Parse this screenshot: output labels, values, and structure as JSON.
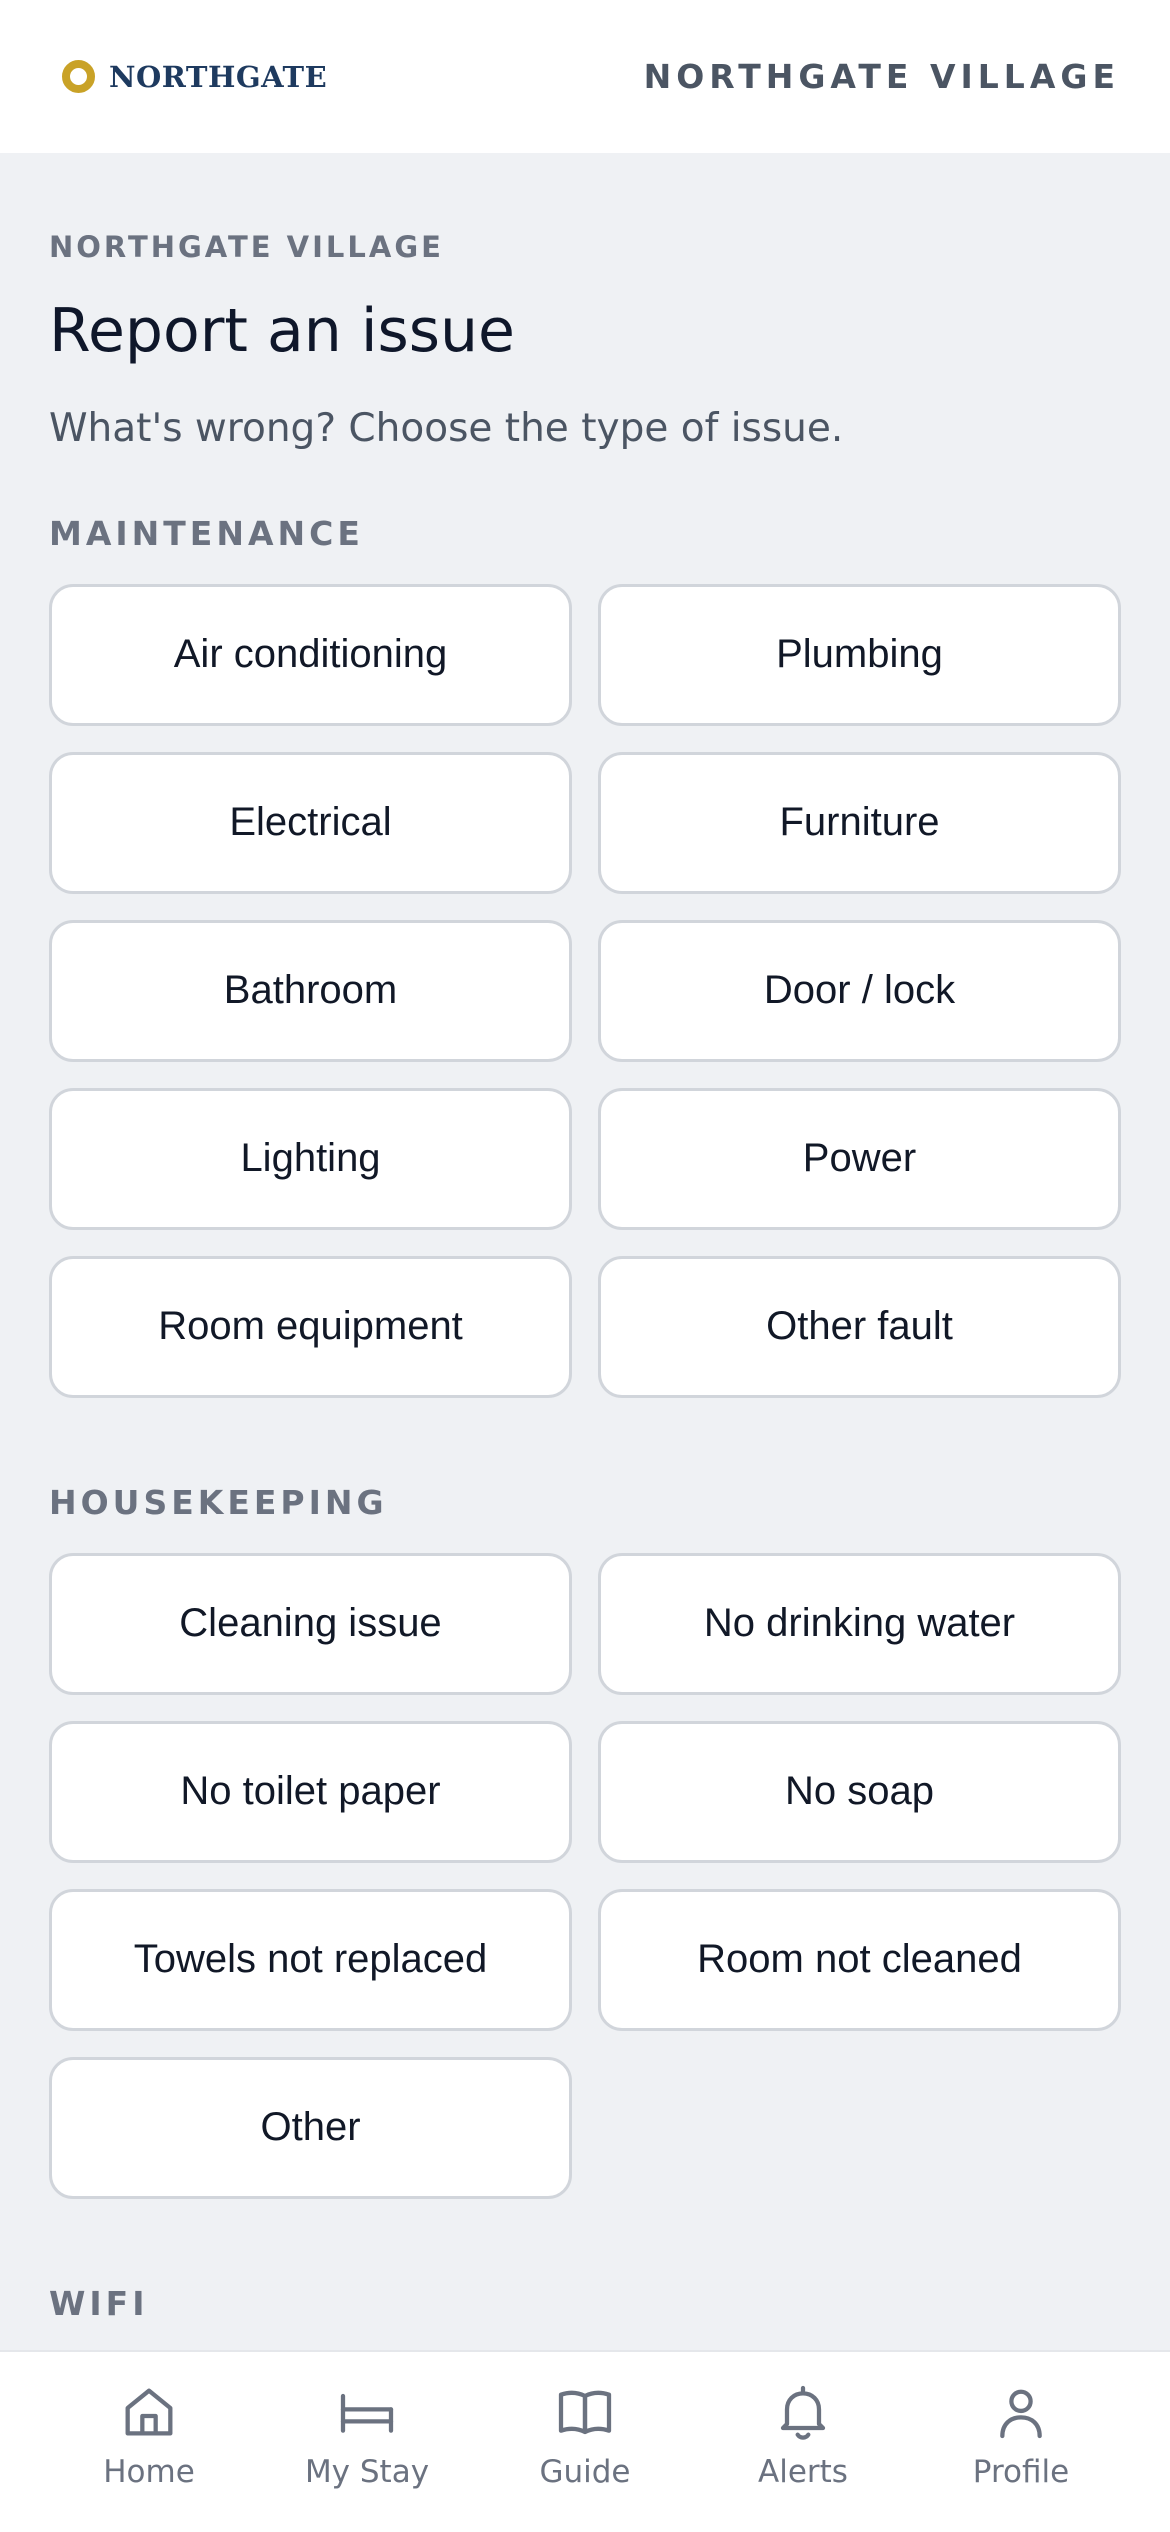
{
  "header": {
    "logo_text": "NORTHGATE",
    "title": "NORTHGATE VILLAGE"
  },
  "page": {
    "eyebrow": "NORTHGATE VILLAGE",
    "title": "Report an issue",
    "subtitle": "What's wrong? Choose the type of issue."
  },
  "sections": {
    "maintenance": {
      "label": "MAINTENANCE",
      "options": [
        "Air conditioning",
        "Plumbing",
        "Electrical",
        "Furniture",
        "Bathroom",
        "Door / lock",
        "Lighting",
        "Power",
        "Room equipment",
        "Other fault"
      ]
    },
    "housekeeping": {
      "label": "HOUSEKEEPING",
      "options": [
        "Cleaning issue",
        "No drinking water",
        "No toilet paper",
        "No soap",
        "Towels not replaced",
        "Room not cleaned",
        "Other"
      ]
    },
    "wifi": {
      "label": "WIFI"
    }
  },
  "nav": {
    "items": [
      "Home",
      "My Stay",
      "Guide",
      "Alerts",
      "Profile"
    ]
  },
  "colors": {
    "background": "#eff1f4",
    "logo_ring": "#c9a227",
    "logo_text": "#1e3a5f",
    "muted": "#6b7280"
  }
}
